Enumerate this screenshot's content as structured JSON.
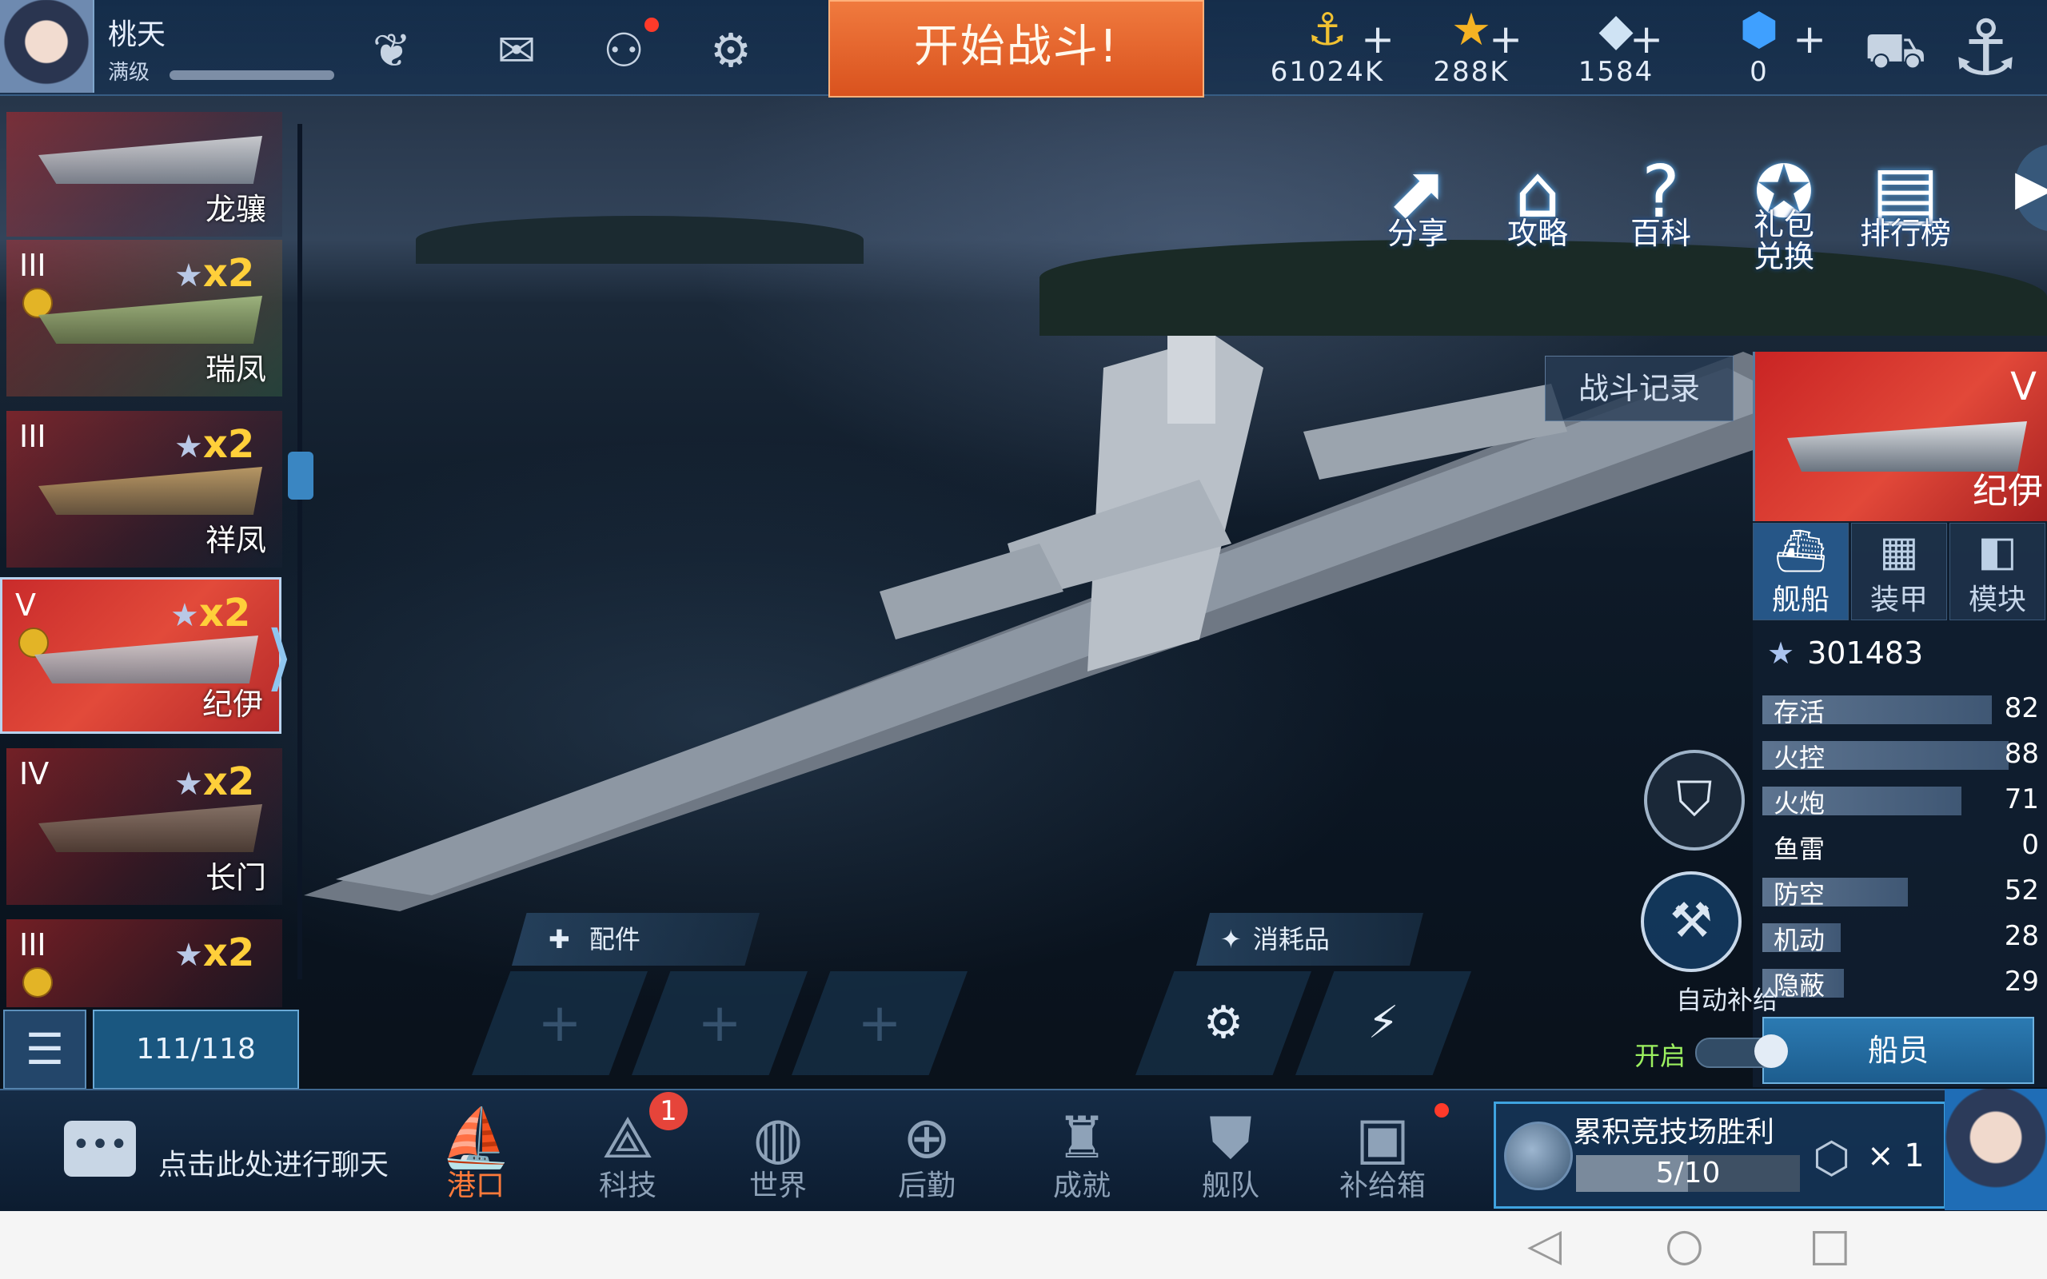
{
  "player": {
    "name": "桃天",
    "level_label": "满级"
  },
  "topbar": {
    "battle_button": "开始战斗!",
    "icons": [
      "wings-icon",
      "mail-icon",
      "friends-icon",
      "settings-icon"
    ],
    "resources": [
      {
        "name": "gold",
        "icon": "gold-coin-icon",
        "value": "61024K"
      },
      {
        "name": "star",
        "icon": "star-icon",
        "value": "288K"
      },
      {
        "name": "diamond",
        "icon": "diamond-icon",
        "value": "1584"
      },
      {
        "name": "crystal",
        "icon": "blue-crystal-icon",
        "value": "0"
      }
    ],
    "shop_icon": "shop-cart-icon",
    "port_icon": "anchor-icon"
  },
  "quick_menu": [
    {
      "label": "分享",
      "icon": "share-icon"
    },
    {
      "label": "攻略",
      "icon": "guide-icon"
    },
    {
      "label": "百科",
      "icon": "encyclopedia-icon"
    },
    {
      "label": "礼包兑换",
      "icon": "gift-redeem-icon"
    },
    {
      "label": "排行榜",
      "icon": "leaderboard-icon"
    }
  ],
  "battle_record": "战斗记录",
  "ship_list": [
    {
      "name": "龙骧",
      "tier": "",
      "stars": ""
    },
    {
      "name": "瑞凤",
      "tier": "III",
      "stars": "x2"
    },
    {
      "name": "祥凤",
      "tier": "III",
      "stars": "x2"
    },
    {
      "name": "纪伊",
      "tier": "V",
      "stars": "x2",
      "selected": true
    },
    {
      "name": "长门",
      "tier": "IV",
      "stars": "x2"
    },
    {
      "name": "",
      "tier": "III",
      "stars": "x2"
    }
  ],
  "ship_count": "111/118",
  "selected_ship": {
    "name": "纪伊",
    "tier": "V",
    "score": "301483",
    "tabs": [
      {
        "label": "舰船",
        "icon": "ship-icon",
        "active": true
      },
      {
        "label": "装甲",
        "icon": "armor-icon",
        "active": false
      },
      {
        "label": "模块",
        "icon": "module-icon",
        "active": false
      }
    ],
    "stats": [
      {
        "label": "存活",
        "value": "82"
      },
      {
        "label": "火控",
        "value": "88"
      },
      {
        "label": "火炮",
        "value": "71"
      },
      {
        "label": "鱼雷",
        "value": "0"
      },
      {
        "label": "防空",
        "value": "52"
      },
      {
        "label": "机动",
        "value": "28"
      },
      {
        "label": "隐蔽",
        "value": "29"
      }
    ],
    "crew_button": "船员"
  },
  "auto_supply": {
    "label": "自动补给",
    "toggle_label": "开启",
    "enabled": true
  },
  "loadout": {
    "parts_label": "配件",
    "consumables_label": "消耗品"
  },
  "chat_placeholder": "点击此处进行聊天",
  "bottom_nav": [
    {
      "label": "港口",
      "icon": "port-icon",
      "active": true
    },
    {
      "label": "科技",
      "icon": "tech-icon",
      "badge": "1"
    },
    {
      "label": "世界",
      "icon": "globe-icon"
    },
    {
      "label": "后勤",
      "icon": "logistics-icon"
    },
    {
      "label": "成就",
      "icon": "achievement-icon"
    },
    {
      "label": "舰队",
      "icon": "fleet-icon"
    },
    {
      "label": "补给箱",
      "icon": "supply-box-icon"
    }
  ],
  "arena": {
    "title": "累积竞技场胜利",
    "progress": "5/10",
    "progress_fraction": 0.5,
    "reward_count": "× 1"
  },
  "colors": {
    "battle_button": "#e0602a",
    "accent": "#3a86c2",
    "selected_flag": "#d33a2e"
  }
}
